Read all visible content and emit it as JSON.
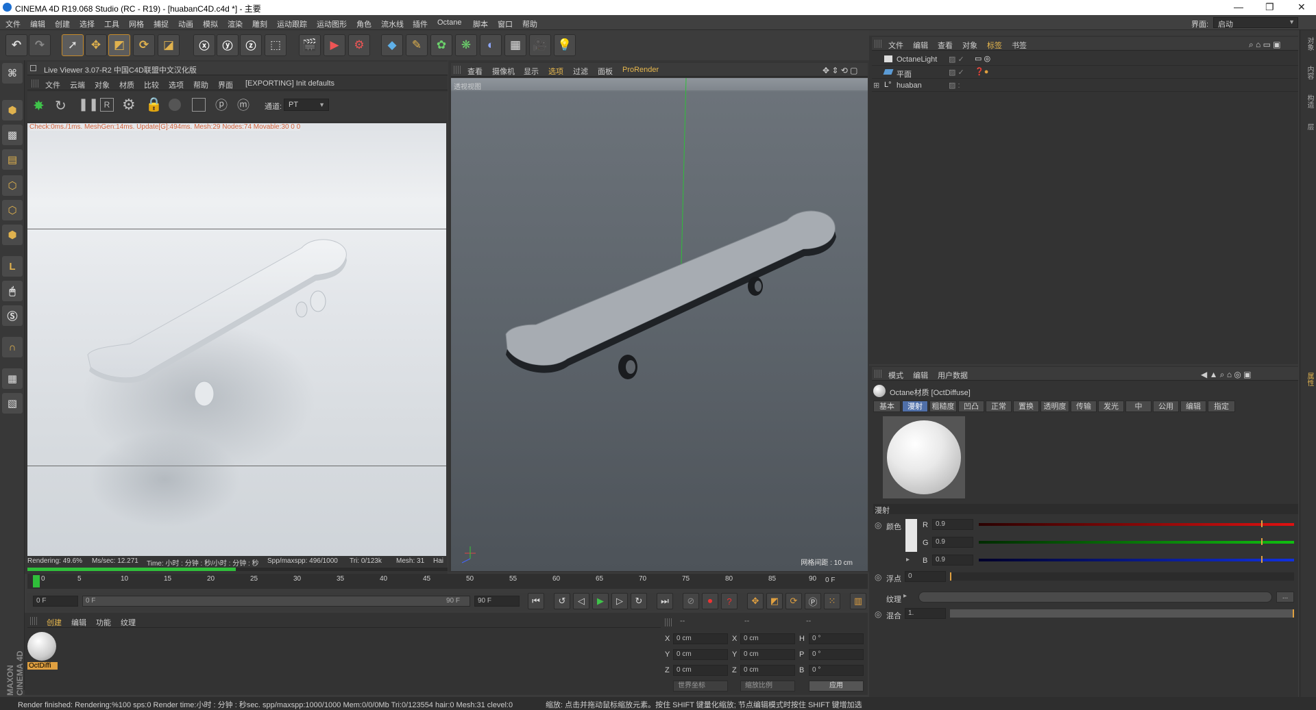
{
  "window": {
    "title": "CINEMA 4D R19.068 Studio (RC - R19) - [huabanC4D.c4d *] - 主要",
    "controls": [
      "—",
      "❐",
      "✕"
    ]
  },
  "menu": [
    "文件",
    "编辑",
    "创建",
    "选择",
    "工具",
    "网格",
    "捕捉",
    "动画",
    "模拟",
    "渲染",
    "雕刻",
    "运动跟踪",
    "运动图形",
    "角色",
    "流水线",
    "插件",
    "Octane",
    "脚本",
    "窗口",
    "帮助"
  ],
  "layout": {
    "label": "界面:",
    "value": "启动"
  },
  "live_viewer": {
    "title": "Live Viewer 3.07-R2 中国C4D联盟中文汉化版",
    "menu": [
      "文件",
      "云端",
      "对象",
      "材质",
      "比较",
      "选项",
      "帮助",
      "界面"
    ],
    "export_status": "[EXPORTING] Init defaults",
    "channel_label": "通道:",
    "channel_value": "PT",
    "stats_line": "Check:0ms./1ms. MeshGen:14ms. Update[G]:494ms. Mesh:29 Nodes:74 Movable:30  0 0",
    "render_status": {
      "rendering": "Rendering: 49.6%",
      "ms_sec": "Ms/sec: 12.271",
      "time": "Time: 小时 : 分钟 : 秒/小时 : 分钟 : 秒",
      "spp": "Spp/maxspp: 496/1000",
      "tri": "Tri: 0/123k",
      "mesh": "Mesh: 31",
      "hair": "Hai"
    },
    "progress": 0.496
  },
  "viewport": {
    "menu": [
      "查看",
      "摄像机",
      "显示",
      "选项",
      "过滤",
      "面板"
    ],
    "prorender": "ProRender",
    "view_name": "透视视图",
    "grid_label": "网格间距 : 10 cm"
  },
  "object_manager": {
    "menu": [
      "文件",
      "编辑",
      "查看",
      "对象",
      "标签",
      "书签"
    ],
    "objects": [
      {
        "name": "OctaneLight"
      },
      {
        "name": "平面"
      },
      {
        "name": "huaban"
      }
    ]
  },
  "attribute_manager": {
    "menu": [
      "模式",
      "编辑",
      "用户数据"
    ],
    "material_title": "Octane材质 [OctDiffuse]",
    "tabs": [
      "基本",
      "漫射",
      "粗糙度",
      "凹凸",
      "正常",
      "置换",
      "透明度",
      "传输",
      "发光",
      "中",
      "公用",
      "编辑",
      "指定"
    ],
    "active_tab": "漫射",
    "section": "漫射",
    "color_label": "颜色",
    "r_label": "R",
    "r_value": "0.9",
    "g_label": "G",
    "g_value": "0.9",
    "b_label": "B",
    "b_value": "0.9",
    "float_label": "浮点",
    "float_value": "0",
    "texture_label": "纹理",
    "mix_label": "混合",
    "mix_value": "1.",
    "more_btn": "..."
  },
  "timeline": {
    "ticks": [
      "0",
      "5",
      "10",
      "15",
      "20",
      "25",
      "30",
      "35",
      "40",
      "45",
      "50",
      "55",
      "60",
      "65",
      "70",
      "75",
      "80",
      "85",
      "90"
    ],
    "end_frame": "0 F"
  },
  "transport": {
    "start": "0 F",
    "range_start": "0 F",
    "range_end": "90 F",
    "end": "90 F"
  },
  "material_manager": {
    "menu": [
      "创建",
      "编辑",
      "功能",
      "纹理"
    ],
    "material_name": "OctDiffi"
  },
  "coordinates": {
    "header": [
      "--",
      "--",
      "--"
    ],
    "rows": [
      {
        "a": "X",
        "v1": "0 cm",
        "b": "X",
        "v2": "0 cm",
        "c": "H",
        "v3": "0 °"
      },
      {
        "a": "Y",
        "v1": "0 cm",
        "b": "Y",
        "v2": "0 cm",
        "c": "P",
        "v3": "0 °"
      },
      {
        "a": "Z",
        "v1": "0 cm",
        "b": "Z",
        "v2": "0 cm",
        "c": "B",
        "v3": "0 °"
      }
    ],
    "mode1": "世界坐标",
    "mode2": "缩放比例",
    "apply": "应用"
  },
  "status": {
    "left": "Render finished: Rendering:%100 sps:0 Render time:小时 : 分钟 : 秒sec. spp/maxspp:1000/1000 Mem:0/0/0Mb Tri:0/123554 hair:0 Mesh:31 clevel:0",
    "right": "缩放: 点击并拖动鼠标缩放元素。按住 SHIFT 键量化缩放; 节点编辑模式时按住 SHIFT 键增加选"
  },
  "brand": "MAXON CINEMA 4D",
  "accent_colors": {
    "active_tab": "#4f6fa8",
    "orange": "#e0a040",
    "progress": "#2fbf3a"
  }
}
